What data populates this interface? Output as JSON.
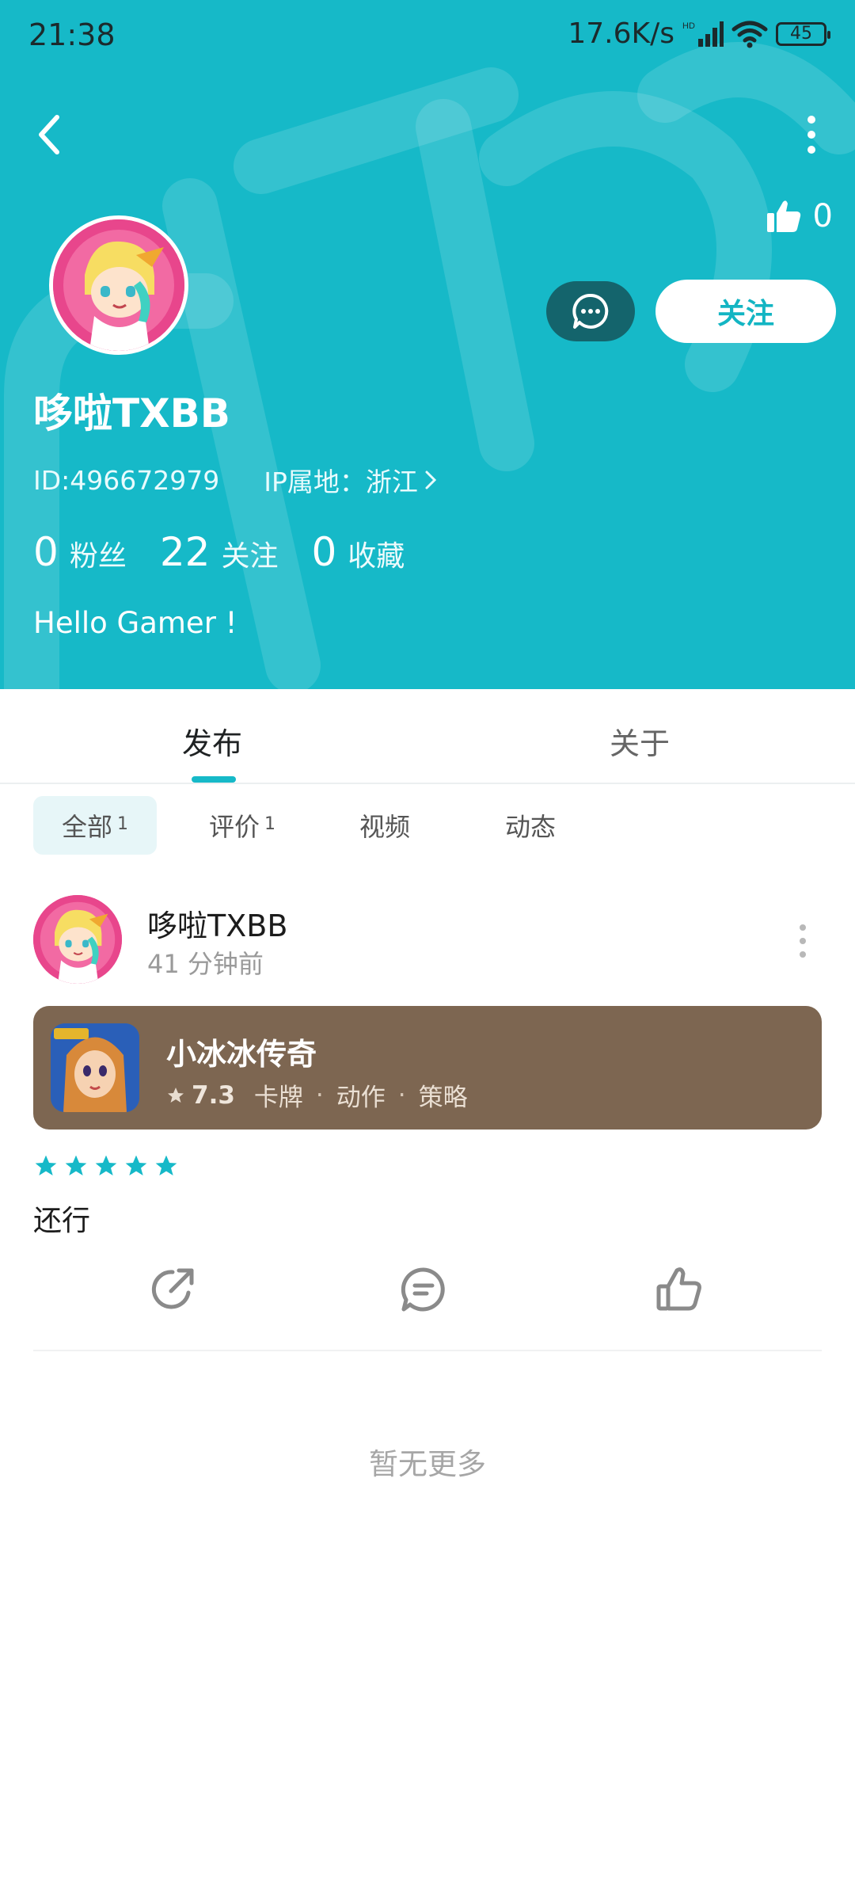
{
  "status_bar": {
    "time": "21:38",
    "network_speed": "17.6K/s",
    "network_type": "HD",
    "battery": "45"
  },
  "header": {
    "background_color": "#16b9c8",
    "like_count": "0",
    "follow_label": "关注",
    "username": "哆啦TXBB",
    "id": "ID:496672979",
    "ip_location": "IP属地：浙江",
    "bio": "Hello Gamer !"
  },
  "stats": [
    {
      "count": "0",
      "label": "粉丝"
    },
    {
      "count": "22",
      "label": "关注"
    },
    {
      "count": "0",
      "label": "收藏"
    }
  ],
  "tabs": {
    "publish": "发布",
    "about": "关于",
    "active": "发布"
  },
  "subtabs": {
    "all_label": "全部",
    "all_count": "1",
    "review_label": "评价",
    "review_count": "1",
    "video_label": "视频",
    "moment_label": "动态",
    "active": "全部"
  },
  "post": {
    "author": "哆啦TXBB",
    "time": "41 分钟前",
    "game": {
      "name": "小冰冰传奇",
      "rating": "7.3",
      "tags": [
        "卡牌",
        "动作",
        "策略"
      ],
      "card_color": "#7d6651"
    },
    "star_rating": 5,
    "text": "还行"
  },
  "footer": {
    "no_more": "暂无更多"
  }
}
